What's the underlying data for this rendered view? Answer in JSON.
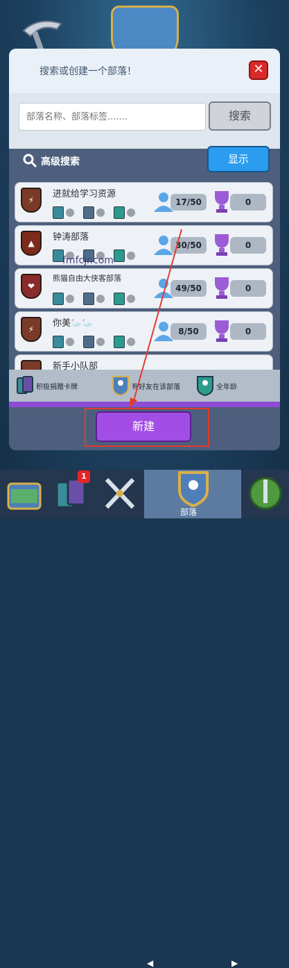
{
  "dialog": {
    "title": "搜索或创建一个部落！",
    "search": {
      "placeholder": "部落名称、部落标签.......",
      "button_label": "搜索"
    },
    "advanced": {
      "label": "高级搜索",
      "show_button": "显示"
    },
    "clans": [
      {
        "name": "进就给学习资源",
        "members": "17/50",
        "trophies": "0"
      },
      {
        "name": "钟涛部落",
        "members": "30/50",
        "trophies": "0"
      },
      {
        "name": "熊猫自由大侠客部落",
        "members": "49/50",
        "trophies": "0"
      },
      {
        "name": "你美🦢🦢",
        "members": "8/50",
        "trophies": "0"
      },
      {
        "name": "新手小队部",
        "members": "",
        "trophies": ""
      }
    ],
    "legend": [
      {
        "label": "积极捐赠卡牌"
      },
      {
        "label": "有好友在该部落"
      },
      {
        "label": "全年龄"
      }
    ],
    "create_button": "新建"
  },
  "watermark": "fmfcjr.com",
  "navbar": {
    "active_label": "部落",
    "notification_count": "1"
  }
}
